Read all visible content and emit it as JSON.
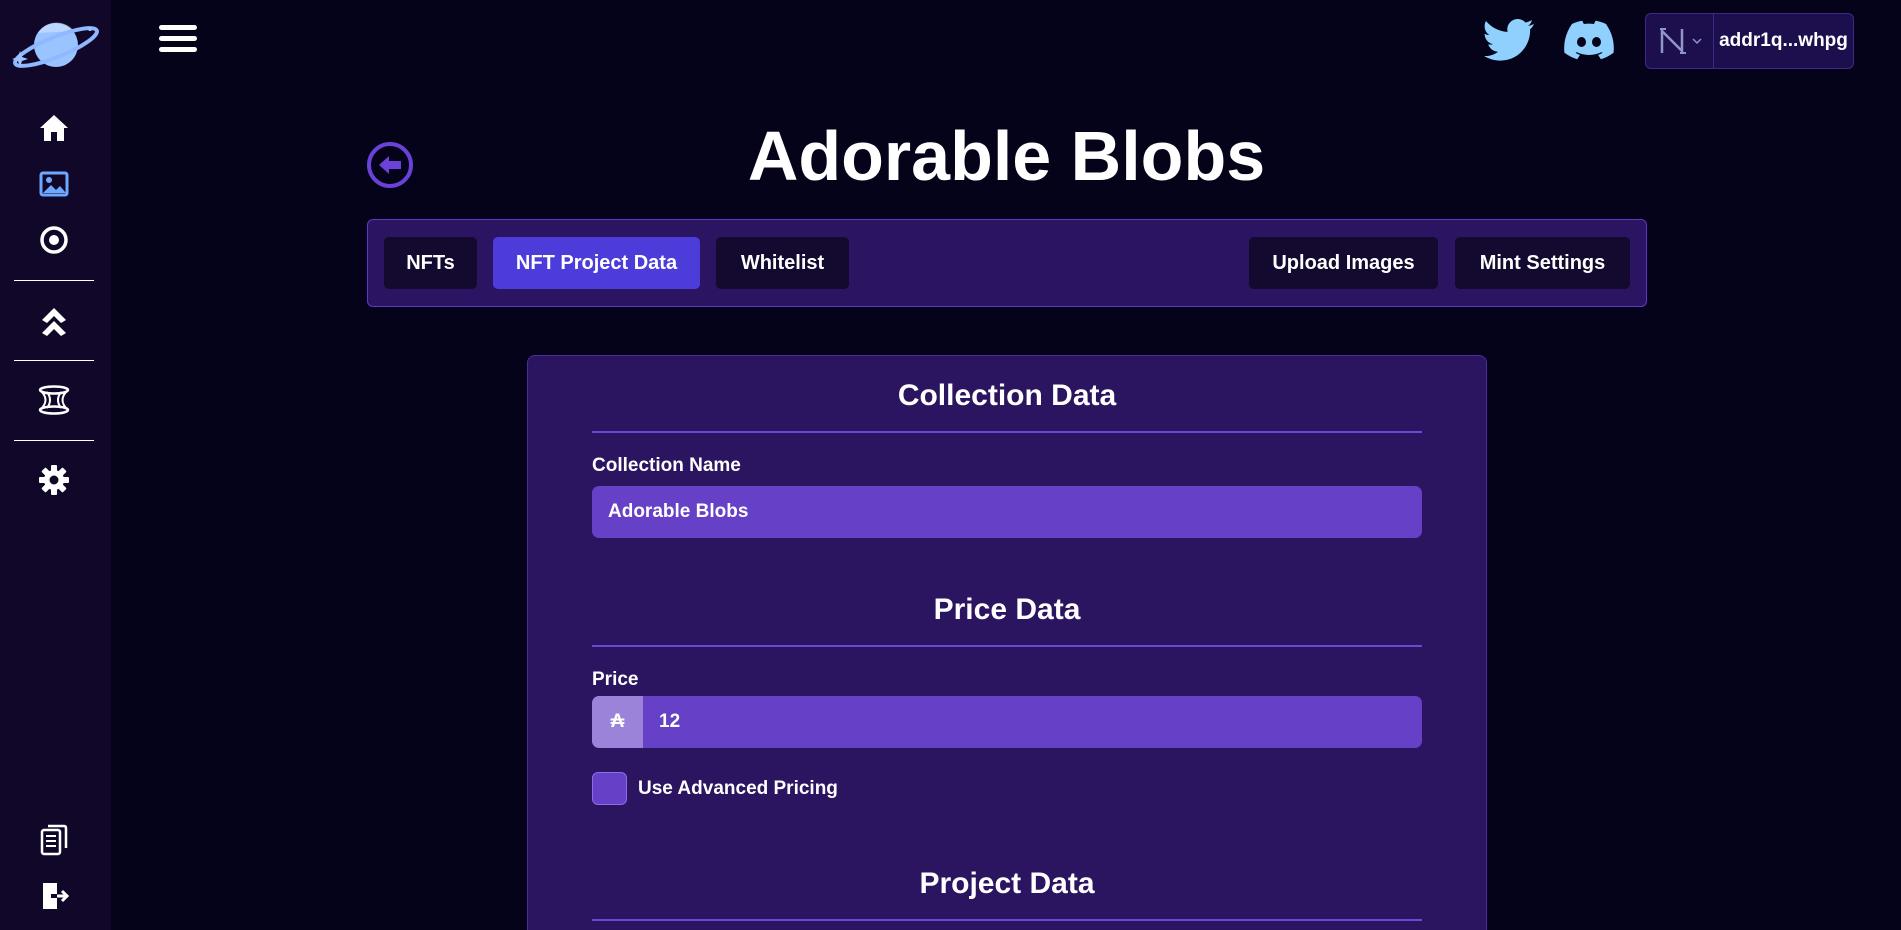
{
  "header": {
    "wallet_address": "addr1q...whpg"
  },
  "page": {
    "title": "Adorable Blobs"
  },
  "tabs": {
    "nfts": "NFTs",
    "project_data": "NFT Project Data",
    "whitelist": "Whitelist",
    "upload_images": "Upload Images",
    "mint_settings": "Mint Settings",
    "active": "NFT Project Data"
  },
  "form": {
    "collection_section": "Collection Data",
    "collection_name_label": "Collection Name",
    "collection_name_value": "Adorable Blobs",
    "price_section": "Price Data",
    "price_label": "Price",
    "price_prefix": "₳",
    "price_value": "12",
    "advanced_pricing_label": "Use Advanced Pricing",
    "project_section": "Project Data"
  },
  "colors": {
    "background": "#05031a",
    "sidebar": "#110829",
    "accent": "#4c3ddb",
    "input": "#6640c6",
    "card": "#2b1460",
    "twitter": "#8fd0ff"
  },
  "icons": [
    "planet-logo-icon",
    "menu-icon",
    "home-icon",
    "image-icon",
    "compass-icon",
    "chevrons-up-icon",
    "portal-icon",
    "gear-icon",
    "documents-icon",
    "logout-icon",
    "twitter-icon",
    "discord-icon",
    "wallet-n-icon",
    "chevron-down-icon",
    "arrow-left-icon"
  ]
}
